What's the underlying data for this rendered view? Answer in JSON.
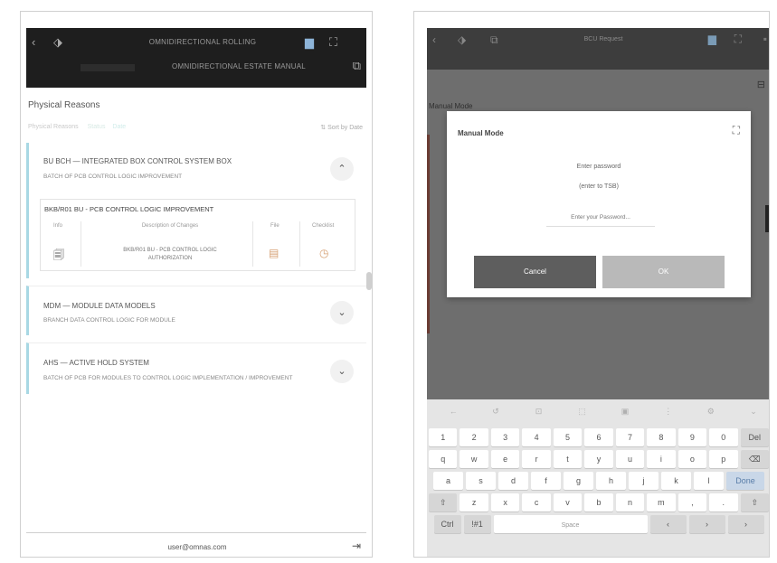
{
  "left": {
    "topbar": {
      "back": "‹",
      "app_glyph": "⬗",
      "title": "OMNIDIRECTIONAL ROLLING",
      "subtitle": "OMNIDIRECTIONAL ESTATE MANUAL",
      "icon_a": "▆",
      "icon_b": "⛶",
      "icon_c": "⧉"
    },
    "section_title": "Physical Reasons",
    "filters": [
      "Physical Reasons",
      "Status",
      "Date"
    ],
    "sort_label": "⇅ Sort by Date",
    "cards": [
      {
        "title": "BU BCH — INTEGRATED BOX CONTROL SYSTEM BOX",
        "subtitle": "BATCH OF PCB CONTROL LOGIC IMPROVEMENT",
        "chevron": "⌃",
        "expanded": true,
        "detail": {
          "title": "BKB/R01 BU - PCB CONTROL LOGIC IMPROVEMENT",
          "columns": [
            "Info",
            "Description of Changes",
            "File",
            "Checklist"
          ],
          "row_text": "BKB/R01 BU - PCB CONTROL LOGIC AUTHORIZATION"
        }
      },
      {
        "title": "MDM — MODULE DATA MODELS",
        "subtitle": "BRANCH DATA CONTROL LOGIC FOR MODULE",
        "chevron": "⌄",
        "expanded": false
      },
      {
        "title": "AHS — ACTIVE HOLD SYSTEM",
        "subtitle": "BATCH OF PCB FOR MODULES TO CONTROL LOGIC IMPLEMENTATION / IMPROVEMENT",
        "chevron": "⌄",
        "expanded": false
      }
    ],
    "footer_email": "user@omnas.com",
    "icons": {
      "doc": "🗐",
      "pdf": "▤",
      "clock": "◷",
      "logout": "⇥"
    }
  },
  "right": {
    "topbar": {
      "back": "‹",
      "app_glyph": "⬗",
      "app2": "⧉",
      "title": "BCU Request",
      "icon_a": "▆",
      "icon_b": "⛶",
      "icon_c": "▪"
    },
    "background_title": "Manual Mode",
    "menu_icon": "⊟",
    "modal": {
      "title": "Manual Mode",
      "close": "⛶",
      "line1": "Enter password",
      "line2": "(enter to TSB)",
      "placeholder": "Enter your Password...",
      "cancel_label": "Cancel",
      "ok_label": "OK"
    },
    "keyboard": {
      "suggestions": [
        "←",
        "↺",
        "⊡",
        "⬚",
        "▣",
        "⋮",
        "⚙",
        "⌄"
      ],
      "rows": [
        [
          "1",
          "2",
          "3",
          "4",
          "5",
          "6",
          "7",
          "8",
          "9",
          "0",
          "Del"
        ],
        [
          "q",
          "w",
          "e",
          "r",
          "t",
          "y",
          "u",
          "i",
          "o",
          "p",
          "⌫"
        ],
        [
          "a",
          "s",
          "d",
          "f",
          "g",
          "h",
          "j",
          "k",
          "l",
          "Done"
        ],
        [
          "⇧",
          "z",
          "x",
          "c",
          "v",
          "b",
          "n",
          "m",
          ",",
          ".",
          "⇧"
        ],
        [
          "Ctrl",
          "!#1",
          "Space",
          "‹",
          "›",
          "›"
        ]
      ],
      "space_label": "Space"
    }
  }
}
